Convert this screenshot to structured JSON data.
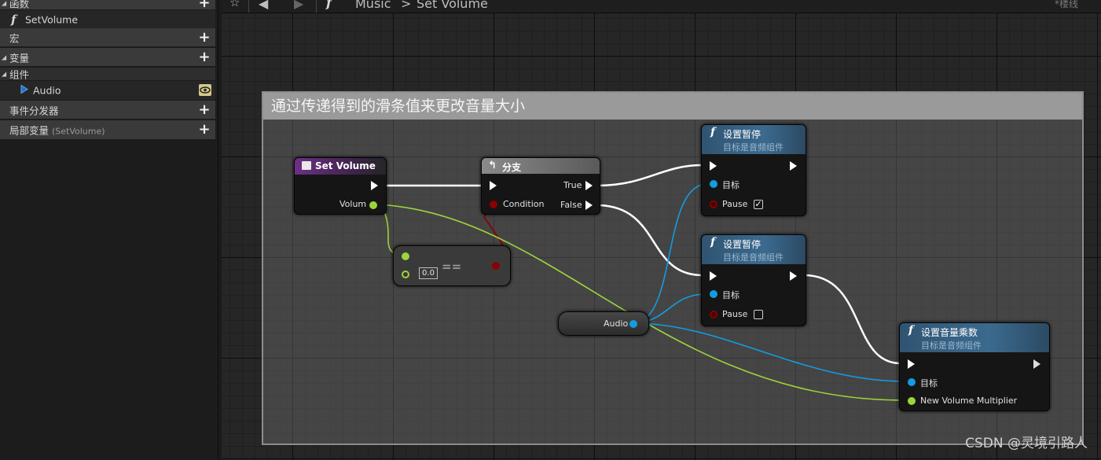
{
  "sidebar": {
    "functions_header": "函数",
    "function_item": "SetVolume",
    "macros": "宏",
    "variables": "变量",
    "components": "组件",
    "component_item": "Audio",
    "event_dispatchers": "事件分发器",
    "local_vars": "局部变量",
    "local_vars_scope": "(SetVolume)"
  },
  "breadcrumb": {
    "parent": "Music",
    "separator": ">",
    "current": "Set Volume",
    "right_label": "*楼线"
  },
  "comment": {
    "title": "通过传递得到的滑条值来更改音量大小"
  },
  "nodes": {
    "set_volume": {
      "title": "Set Volume",
      "pin_volume": "Volum"
    },
    "branch": {
      "title": "分支",
      "pin_condition": "Condition",
      "pin_true": "True",
      "pin_false": "False"
    },
    "equal": {
      "operator": "==",
      "default_value": "0.0"
    },
    "audio_var": {
      "label": "Audio"
    },
    "set_paused_1": {
      "title": "设置暂停",
      "subtitle": "目标是音频组件",
      "pin_target": "目标",
      "pin_pause": "Pause",
      "pause_checked": true
    },
    "set_paused_2": {
      "title": "设置暂停",
      "subtitle": "目标是音频组件",
      "pin_target": "目标",
      "pin_pause": "Pause",
      "pause_checked": false
    },
    "set_volume_mult": {
      "title": "设置音量乘数",
      "subtitle": "目标是音频组件",
      "pin_target": "目标",
      "pin_multiplier": "New Volume Multiplier"
    }
  },
  "colors": {
    "exec_wire": "#ffffff",
    "float_wire": "#9bd43c",
    "object_wire": "#139ce0",
    "bool_wire": "#8b0000",
    "function_header": "#2f5472",
    "event_header": "#6e2f86"
  },
  "watermark": "CSDN @灵境引路人"
}
